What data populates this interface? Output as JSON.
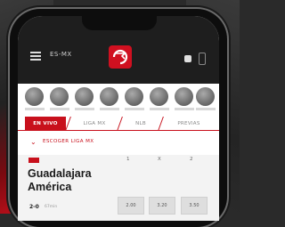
{
  "header": {
    "region_label": "ES-MX"
  },
  "tabs": [
    {
      "label": "EN VIVO"
    },
    {
      "label": "LIGA MX"
    },
    {
      "label": "NLB"
    },
    {
      "label": "PREVIAS"
    }
  ],
  "filter": {
    "label": "ESCOGER LIGA MX"
  },
  "match": {
    "team_home": "Guadalajara",
    "team_away": "América",
    "odds_headers": [
      "1",
      "X",
      "2"
    ],
    "odds": [
      "2.00",
      "3.20",
      "3.50"
    ],
    "score": "2-0",
    "meta": "67min"
  },
  "colors": {
    "accent": "#c8101c",
    "header_bg": "#1e1e1e"
  }
}
